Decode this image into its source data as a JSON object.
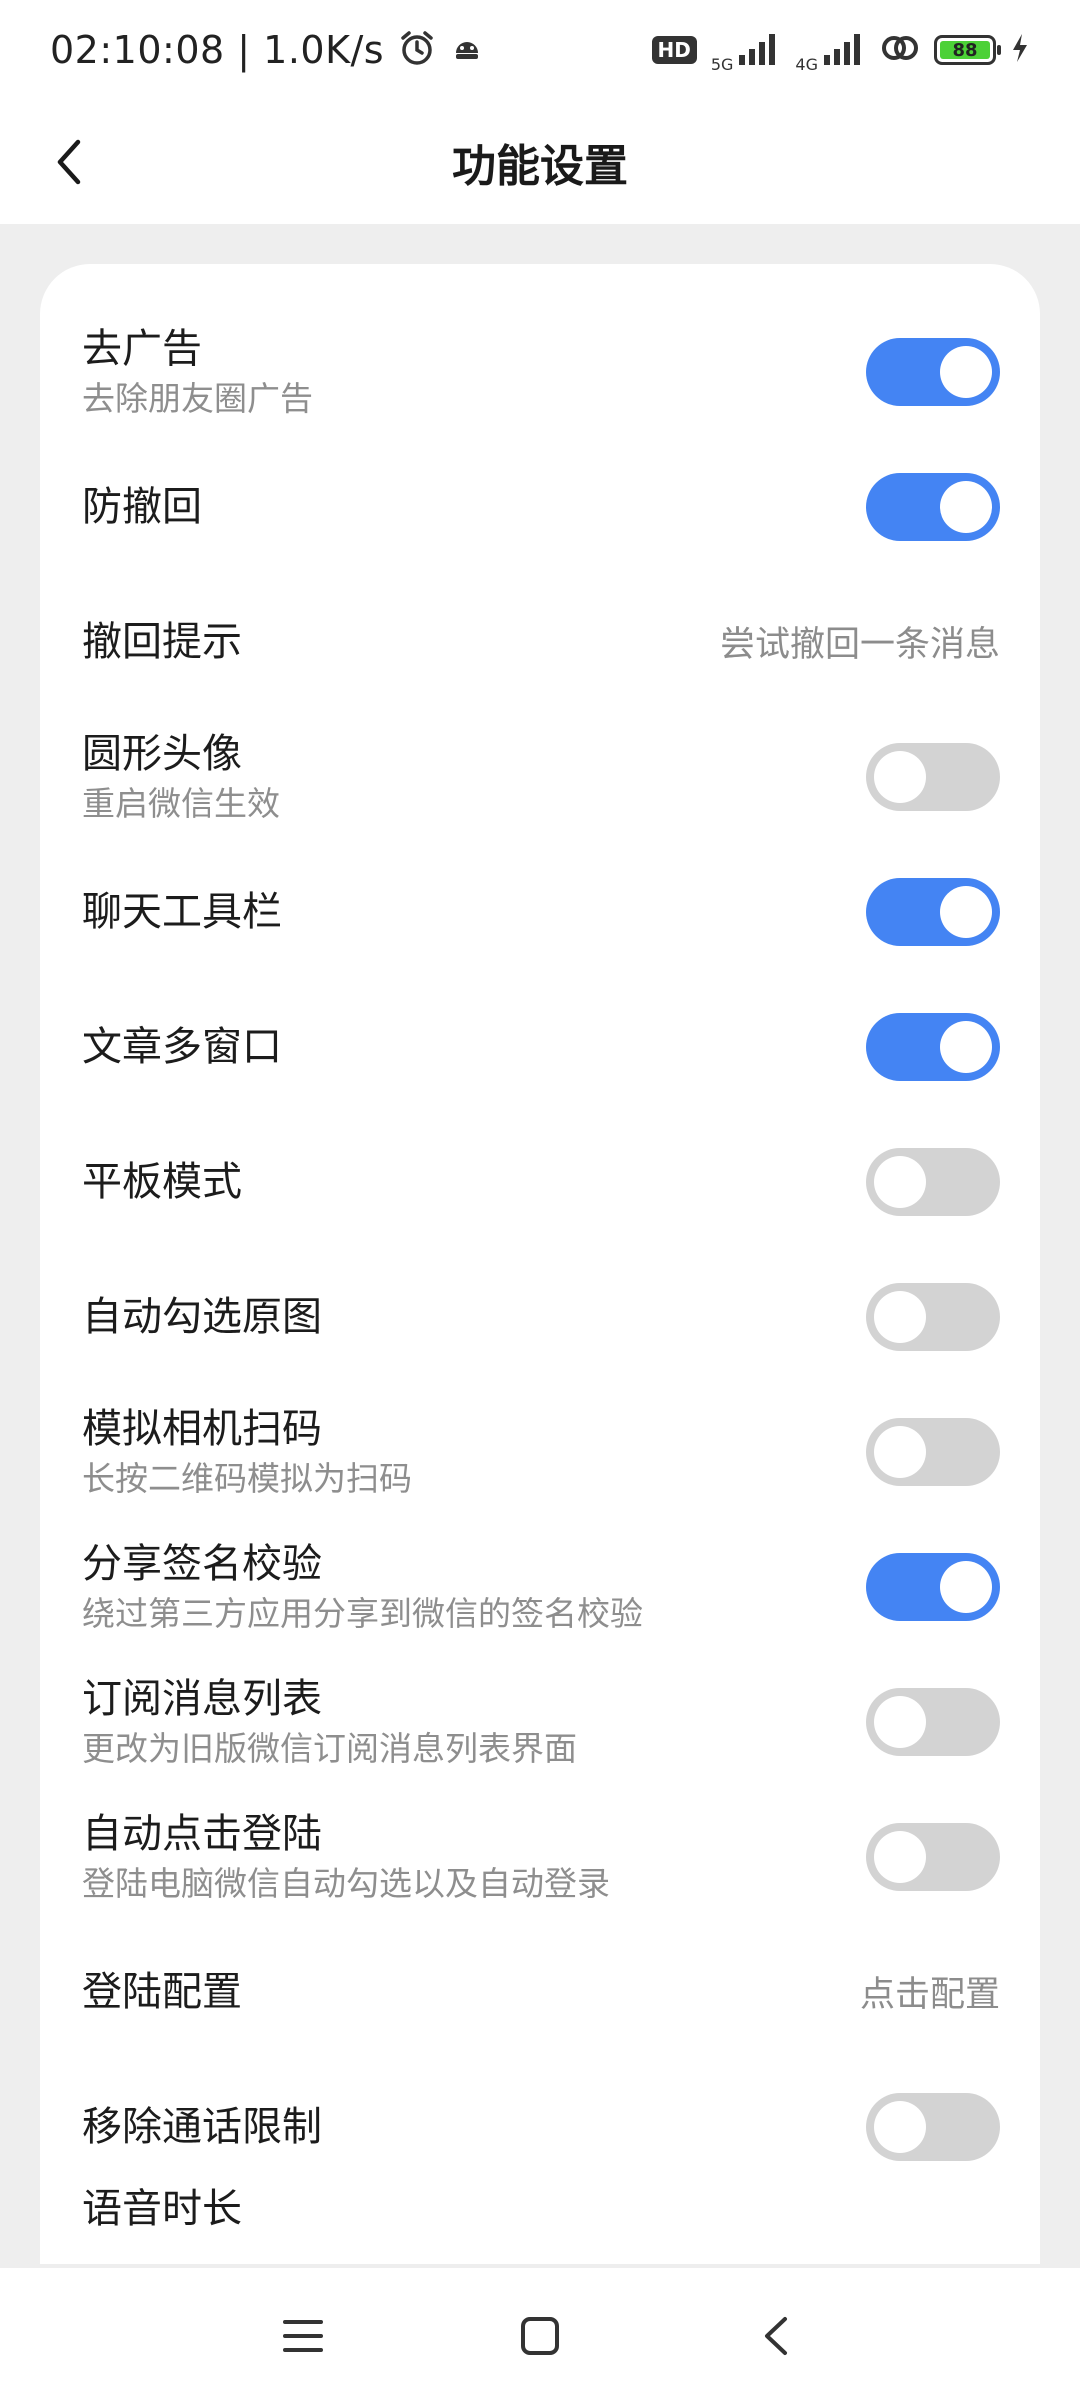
{
  "status_bar": {
    "time": "02:10:08",
    "speed": "1.0K/s",
    "hd_label": "HD",
    "net1": "5G",
    "net2": "4G",
    "battery": "88"
  },
  "header": {
    "title": "功能设置"
  },
  "settings": [
    {
      "title": "去广告",
      "subtitle": "去除朋友圈广告",
      "control": "toggle",
      "on": true
    },
    {
      "title": "防撤回",
      "control": "toggle",
      "on": true
    },
    {
      "title": "撤回提示",
      "control": "text",
      "value": "尝试撤回一条消息"
    },
    {
      "title": "圆形头像",
      "subtitle": "重启微信生效",
      "control": "toggle",
      "on": false
    },
    {
      "title": "聊天工具栏",
      "control": "toggle",
      "on": true
    },
    {
      "title": "文章多窗口",
      "control": "toggle",
      "on": true
    },
    {
      "title": "平板模式",
      "control": "toggle",
      "on": false
    },
    {
      "title": "自动勾选原图",
      "control": "toggle",
      "on": false
    },
    {
      "title": "模拟相机扫码",
      "subtitle": "长按二维码模拟为扫码",
      "control": "toggle",
      "on": false
    },
    {
      "title": "分享签名校验",
      "subtitle": "绕过第三方应用分享到微信的签名校验",
      "control": "toggle",
      "on": true
    },
    {
      "title": "订阅消息列表",
      "subtitle": "更改为旧版微信订阅消息列表界面",
      "control": "toggle",
      "on": false
    },
    {
      "title": "自动点击登陆",
      "subtitle": "登陆电脑微信自动勾选以及自动登录",
      "control": "toggle",
      "on": false
    },
    {
      "title": "登陆配置",
      "control": "text",
      "value": "点击配置"
    },
    {
      "title": "移除通话限制",
      "control": "toggle",
      "on": false
    },
    {
      "title": "语音时长"
    }
  ],
  "colors": {
    "accent": "#4484f3",
    "toggle_off": "#d3d3d3"
  }
}
